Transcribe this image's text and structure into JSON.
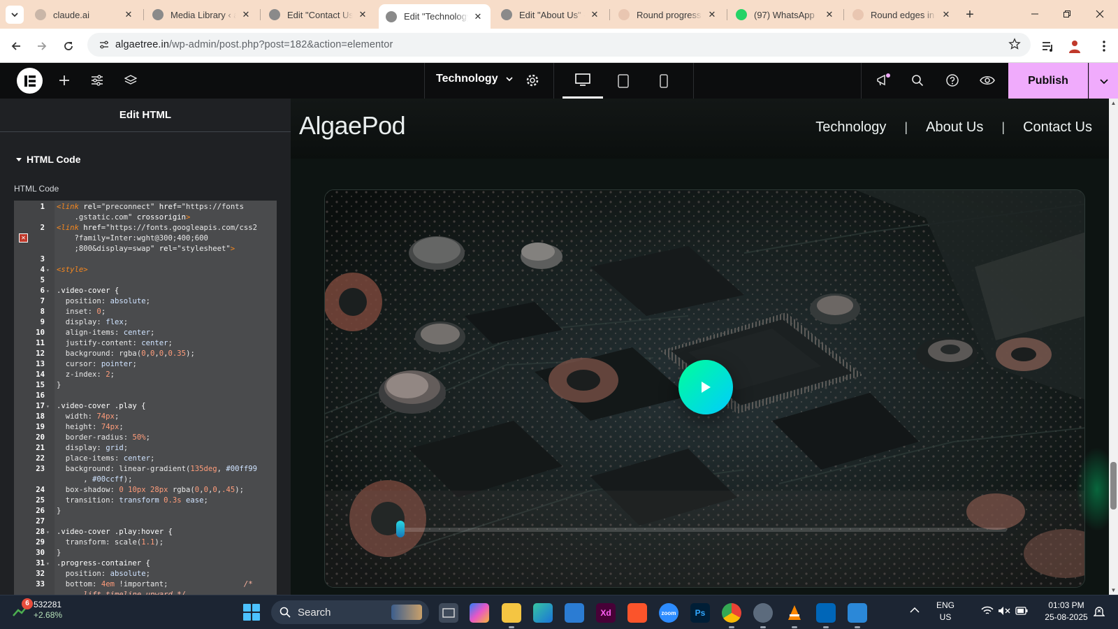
{
  "browser": {
    "tabs": [
      {
        "title": "claude.ai",
        "favicon": "globe-icon",
        "active": false
      },
      {
        "title": "Media Library ‹ algaetree — WordPress",
        "favicon": "wordpress-icon",
        "active": false
      },
      {
        "title": "Edit \"Contact Us\" ‹ algaetree",
        "favicon": "wordpress-icon",
        "active": false
      },
      {
        "title": "Edit \"Technology\" ‹ algaetree",
        "favicon": "wordpress-icon",
        "active": true
      },
      {
        "title": "Edit \"About Us\" ‹ algaetree",
        "favicon": "wordpress-icon",
        "active": false
      },
      {
        "title": "Round progress bar",
        "favicon": "page-icon",
        "active": false
      },
      {
        "title": "(97) WhatsApp",
        "favicon": "whatsapp-icon",
        "active": false
      },
      {
        "title": "Round edges in video",
        "favicon": "page-icon",
        "active": false
      }
    ],
    "url_host": "algaetree.in",
    "url_path": "/wp-admin/post.php?post=182&action=elementor"
  },
  "elementor": {
    "page_name": "Technology",
    "publish_label": "Publish",
    "panel_title": "Edit HTML",
    "section_title": "HTML Code",
    "control_label": "HTML Code",
    "code_lines": [
      {
        "n": "1",
        "fold": "",
        "html": "<span class='t-tag'>&lt;link</span> <span class='t-attr'>rel</span>=<span class='t-str'>\"preconnect\"</span> <span class='t-attr'>href</span>=<span class='t-str'>\"https://fonts</span>"
      },
      {
        "n": "",
        "fold": "",
        "html": "    <span class='t-str'>.gstatic.com\"</span> <span class='t-attr'>crossorigin</span><span class='t-tag'>&gt;</span>"
      },
      {
        "n": "2",
        "fold": "",
        "html": "<span class='t-tag'>&lt;link</span> <span class='t-attr'>href</span>=<span class='t-str'>\"https://fonts.googleapis.com/css2</span>"
      },
      {
        "n": "",
        "fold": "",
        "html": "    <span class='t-str'>?family=Inter:wght@300;400;600</span>"
      },
      {
        "n": "",
        "fold": "",
        "html": "    <span class='t-str'>;800&amp;display=swap\"</span> <span class='t-attr'>rel</span>=<span class='t-str'>\"stylesheet\"</span><span class='t-tag'>&gt;</span>"
      },
      {
        "n": "3",
        "fold": "",
        "html": ""
      },
      {
        "n": "4",
        "fold": "▾",
        "html": "<span class='t-tag'>&lt;style&gt;</span>"
      },
      {
        "n": "5",
        "fold": "",
        "html": ""
      },
      {
        "n": "6",
        "fold": "▾",
        "html": "<span class='t-sel'>.video-cover {</span>"
      },
      {
        "n": "7",
        "fold": "",
        "html": "  <span class='t-prop'>position</span>: <span class='t-val'>absolute</span>;"
      },
      {
        "n": "8",
        "fold": "",
        "html": "  <span class='t-prop'>inset</span>: <span class='t-num'>0</span>;"
      },
      {
        "n": "9",
        "fold": "",
        "html": "  <span class='t-prop'>display</span>: <span class='t-val'>flex</span>;"
      },
      {
        "n": "10",
        "fold": "",
        "html": "  <span class='t-prop'>align-items</span>: <span class='t-val'>center</span>;"
      },
      {
        "n": "11",
        "fold": "",
        "html": "  <span class='t-prop'>justify-content</span>: <span class='t-val'>center</span>;"
      },
      {
        "n": "12",
        "fold": "",
        "html": "  <span class='t-prop'>background</span>: rgba(<span class='t-num'>0</span>,<span class='t-num'>0</span>,<span class='t-num'>0</span>,<span class='t-num'>0.35</span>);"
      },
      {
        "n": "13",
        "fold": "",
        "html": "  <span class='t-prop'>cursor</span>: <span class='t-val'>pointer</span>;"
      },
      {
        "n": "14",
        "fold": "",
        "html": "  <span class='t-prop'>z-index</span>: <span class='t-num'>2</span>;"
      },
      {
        "n": "15",
        "fold": "",
        "html": "}"
      },
      {
        "n": "16",
        "fold": "",
        "html": ""
      },
      {
        "n": "17",
        "fold": "▾",
        "html": "<span class='t-sel'>.video-cover .play {</span>"
      },
      {
        "n": "18",
        "fold": "",
        "html": "  <span class='t-prop'>width</span>: <span class='t-num'>74px</span>;"
      },
      {
        "n": "19",
        "fold": "",
        "html": "  <span class='t-prop'>height</span>: <span class='t-num'>74px</span>;"
      },
      {
        "n": "20",
        "fold": "",
        "html": "  <span class='t-prop'>border-radius</span>: <span class='t-num'>50%</span>;"
      },
      {
        "n": "21",
        "fold": "",
        "html": "  <span class='t-prop'>display</span>: <span class='t-val'>grid</span>;"
      },
      {
        "n": "22",
        "fold": "",
        "html": "  <span class='t-prop'>place-items</span>: <span class='t-val'>center</span>;"
      },
      {
        "n": "23",
        "fold": "",
        "html": "  <span class='t-prop'>background</span>: linear-gradient(<span class='t-num'>135deg</span>, <span class='t-val'>#00ff99</span>"
      },
      {
        "n": "",
        "fold": "",
        "html": "      , <span class='t-val'>#00ccff</span>);"
      },
      {
        "n": "24",
        "fold": "",
        "html": "  <span class='t-prop'>box-shadow</span>: <span class='t-num'>0</span> <span class='t-num'>10px</span> <span class='t-num'>28px</span> rgba(<span class='t-num'>0</span>,<span class='t-num'>0</span>,<span class='t-num'>0</span>,<span class='t-num'>.45</span>);"
      },
      {
        "n": "25",
        "fold": "",
        "html": "  <span class='t-prop'>transition</span>: <span class='t-val'>transform</span> <span class='t-num'>0.3s</span> <span class='t-val'>ease</span>;"
      },
      {
        "n": "26",
        "fold": "",
        "html": "}"
      },
      {
        "n": "27",
        "fold": "",
        "html": ""
      },
      {
        "n": "28",
        "fold": "▾",
        "html": "<span class='t-sel'>.video-cover .play:hover {</span>"
      },
      {
        "n": "29",
        "fold": "",
        "html": "  <span class='t-prop'>transform</span>: scale(<span class='t-num'>1.1</span>);"
      },
      {
        "n": "30",
        "fold": "",
        "html": "}"
      },
      {
        "n": "31",
        "fold": "▾",
        "html": "<span class='t-sel'>.progress-container {</span>"
      },
      {
        "n": "32",
        "fold": "",
        "html": "  <span class='t-prop'>position</span>: <span class='t-val'>absolute</span>;"
      },
      {
        "n": "33",
        "fold": "",
        "html": "  <span class='t-prop'>bottom</span>: <span class='t-num'>4em</span> !important;                 <span class='t-com'>/*</span>"
      },
      {
        "n": "",
        "fold": "",
        "html": "      <span class='t-com'>lift timeline upward */</span>"
      }
    ]
  },
  "site": {
    "brand": "AlgaePod",
    "nav": [
      "Technology",
      "About Us",
      "Contact Us"
    ],
    "video_progress": 0.0
  },
  "taskbar": {
    "stock_badge": "6",
    "stock_value": "532281",
    "stock_change": "+2.68%",
    "search_label": "Search",
    "lang_line1": "ENG",
    "lang_line2": "US",
    "time": "01:03 PM",
    "date": "25-08-2025",
    "apps": [
      "task-view",
      "copilot",
      "file-explorer",
      "edge",
      "store",
      "adobe-xd",
      "brave",
      "zoom",
      "photoshop",
      "chrome",
      "settings",
      "vlc",
      "vscode",
      "notepad"
    ]
  },
  "colors": {
    "publish": "#f0abfc",
    "play_gradient_start": "#00ff99",
    "play_gradient_end": "#00ccff",
    "tabstrip": "#f7ddc9"
  }
}
